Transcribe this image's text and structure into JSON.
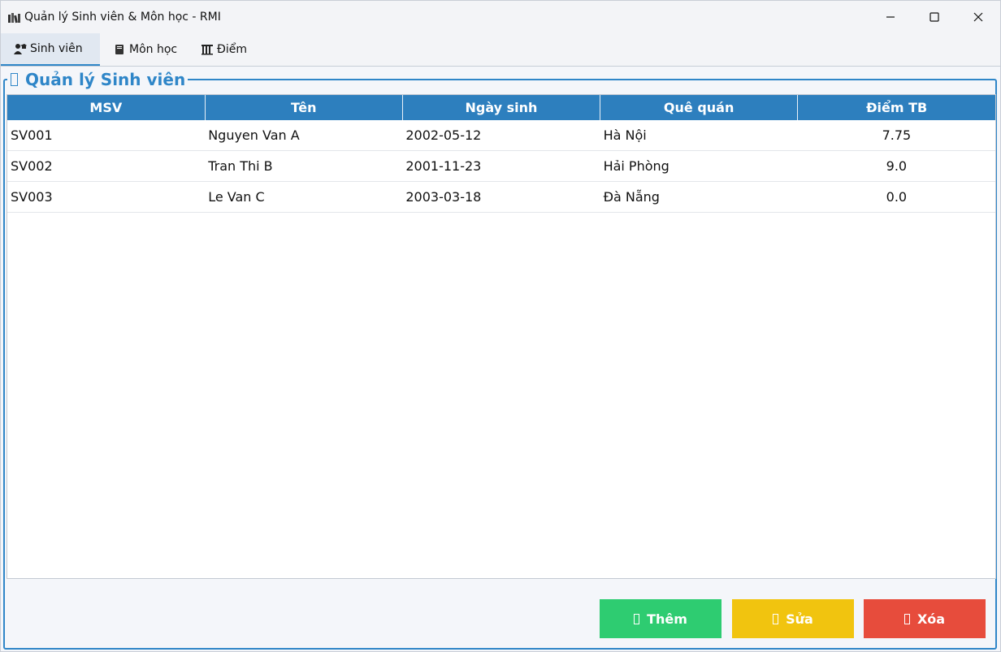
{
  "window": {
    "title": "Quản lý Sinh viên & Môn học - RMI",
    "title_icon": "books-icon"
  },
  "tabs": [
    {
      "label": "Sinh viên",
      "icon": "student-icon",
      "active": true
    },
    {
      "label": "Môn học",
      "icon": "book-icon",
      "active": false
    },
    {
      "label": "Điểm",
      "icon": "chart-icon",
      "active": false
    }
  ],
  "panel": {
    "title": "Quản lý Sinh viên",
    "title_icon": "missing-glyph-icon"
  },
  "table": {
    "columns": [
      "MSV",
      "Tên",
      "Ngày sinh",
      "Quê quán",
      "Điểm TB"
    ],
    "rows": [
      [
        "SV001",
        "Nguyen Van A",
        "2002-05-12",
        "Hà Nội",
        "7.75"
      ],
      [
        "SV002",
        "Tran Thi B",
        "2001-11-23",
        "Hải Phòng",
        "9.0"
      ],
      [
        "SV003",
        "Le Van C",
        "2003-03-18",
        "Đà Nẵng",
        "0.0"
      ]
    ]
  },
  "actions": {
    "add_label": "Thêm",
    "edit_label": "Sửa",
    "delete_label": "Xóa"
  },
  "colors": {
    "accent": "#2f86c8",
    "header_bg": "#2d7fbe",
    "add": "#2ecc71",
    "edit": "#f1c40f",
    "delete": "#e74c3c"
  }
}
